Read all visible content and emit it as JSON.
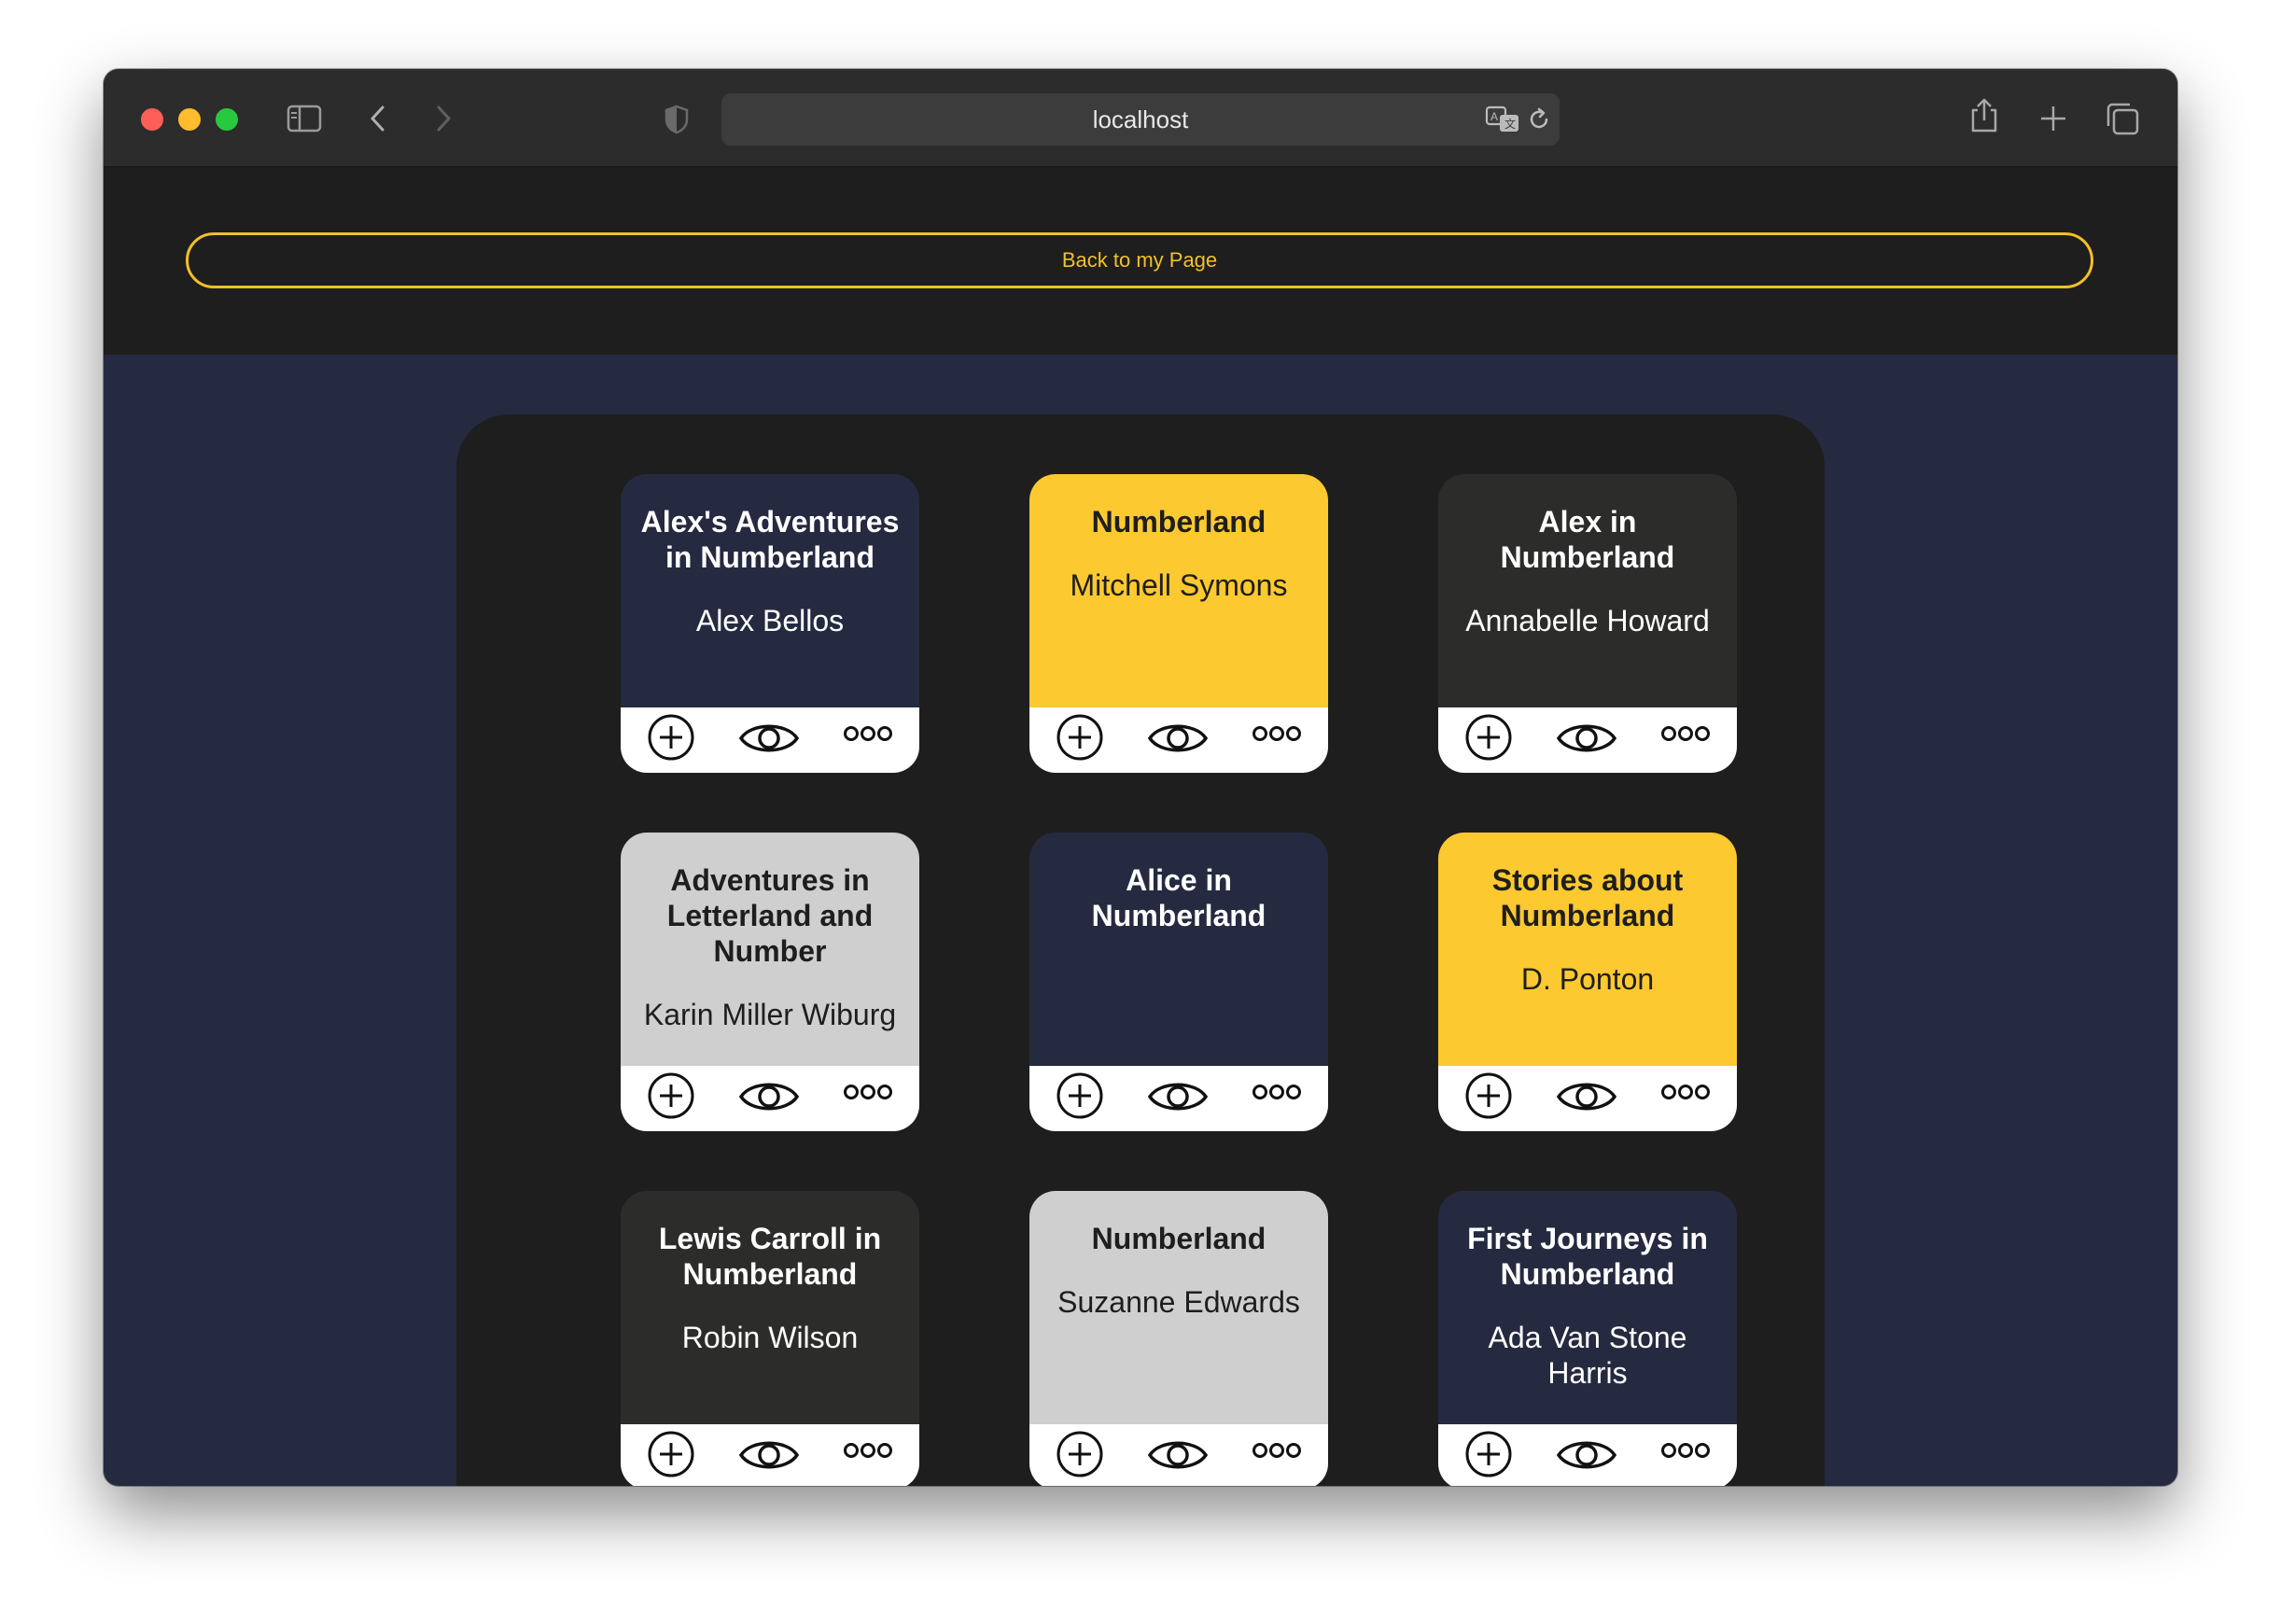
{
  "browser": {
    "url": "localhost"
  },
  "header": {
    "back_label": "Back to my Page"
  },
  "books": [
    {
      "title": "Alex's Adventures in Numberland",
      "author": "Alex Bellos",
      "bg": "#262a40",
      "fg": "#ffffff"
    },
    {
      "title": "Numberland",
      "author": "Mitchell Symons",
      "bg": "#fdc930",
      "fg": "#1e1e1e"
    },
    {
      "title": "Alex in Numberland",
      "author": "Annabelle Howard",
      "bg": "#2c2d2b",
      "fg": "#ffffff"
    },
    {
      "title": "Adventures in Letterland and Number",
      "author": "Karin Miller Wiburg",
      "bg": "#cfcfcf",
      "fg": "#1e1e1e"
    },
    {
      "title": "Alice in Numberland",
      "author": "",
      "bg": "#262a40",
      "fg": "#ffffff"
    },
    {
      "title": "Stories about Numberland",
      "author": "D. Ponton",
      "bg": "#fdc930",
      "fg": "#1e1e1e"
    },
    {
      "title": "Lewis Carroll in Numberland",
      "author": "Robin Wilson",
      "bg": "#2c2d2b",
      "fg": "#ffffff"
    },
    {
      "title": "Numberland",
      "author": "Suzanne Edwards",
      "bg": "#cfcfcf",
      "fg": "#1e1e1e"
    },
    {
      "title": "First Journeys in Numberland",
      "author": "Ada Van Stone Harris",
      "bg": "#262a40",
      "fg": "#ffffff"
    }
  ],
  "card_actions": [
    "plus-circle-icon",
    "eye-icon",
    "more-dots-icon"
  ]
}
